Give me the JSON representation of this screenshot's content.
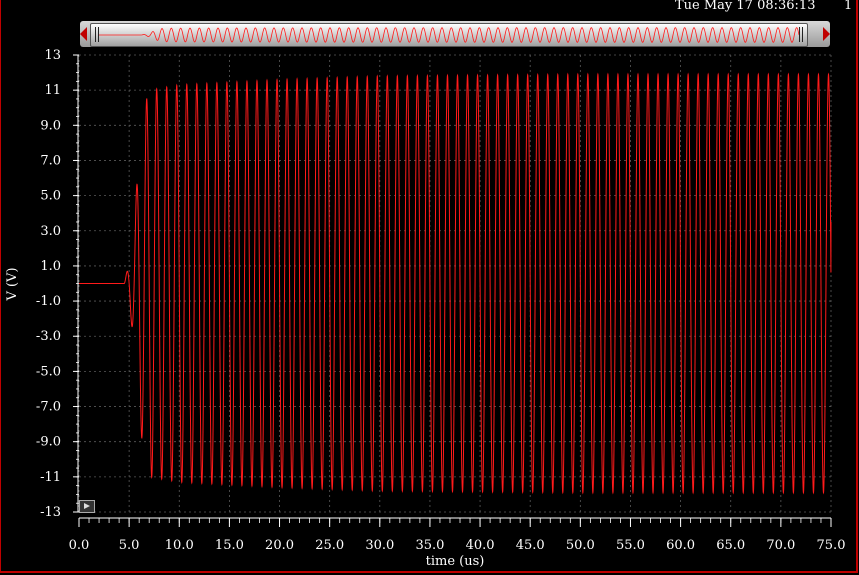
{
  "header": {
    "timestamp": "Tue May 17 08:36:13",
    "page_number": "1"
  },
  "colors": {
    "background": "#000000",
    "trace": "#ff1a1a",
    "axis": "#ffffff",
    "grid": "#5a5a5a"
  },
  "chart_data": {
    "type": "line",
    "title": "",
    "xlabel": "time (us)",
    "ylabel": "V (V)",
    "xlim": [
      0,
      75
    ],
    "ylim": [
      -13,
      13
    ],
    "grid": true,
    "x_ticks": [
      "0.0",
      "5.0",
      "10.0",
      "15.0",
      "20.0",
      "25.0",
      "30.0",
      "35.0",
      "40.0",
      "45.0",
      "50.0",
      "55.0",
      "60.0",
      "65.0",
      "70.0",
      "75.0"
    ],
    "y_ticks": [
      "13",
      "11",
      "9.0",
      "7.0",
      "5.0",
      "3.0",
      "1.0",
      "-1.0",
      "-3.0",
      "-5.0",
      "-7.0",
      "-9.0",
      "-11",
      "-13"
    ],
    "series": [
      {
        "name": "",
        "signal": "oscillation",
        "start_time": 0,
        "onset_time": 4.5,
        "period": 1.0,
        "envelope": [
          [
            0,
            0
          ],
          [
            4.5,
            0
          ],
          [
            5.0,
            1.2
          ],
          [
            5.5,
            3.5
          ],
          [
            6.0,
            7.5
          ],
          [
            6.5,
            10.0
          ],
          [
            7.0,
            11.0
          ],
          [
            10.0,
            11.3
          ],
          [
            20.0,
            11.6
          ],
          [
            30.0,
            11.8
          ],
          [
            50.0,
            11.9
          ],
          [
            75.0,
            11.9
          ]
        ],
        "end_value": 3.5
      }
    ]
  },
  "controls": {
    "play_icon": "play-icon",
    "scroll_left_icon": "arrow-left-icon",
    "scroll_right_icon": "arrow-right-icon"
  }
}
